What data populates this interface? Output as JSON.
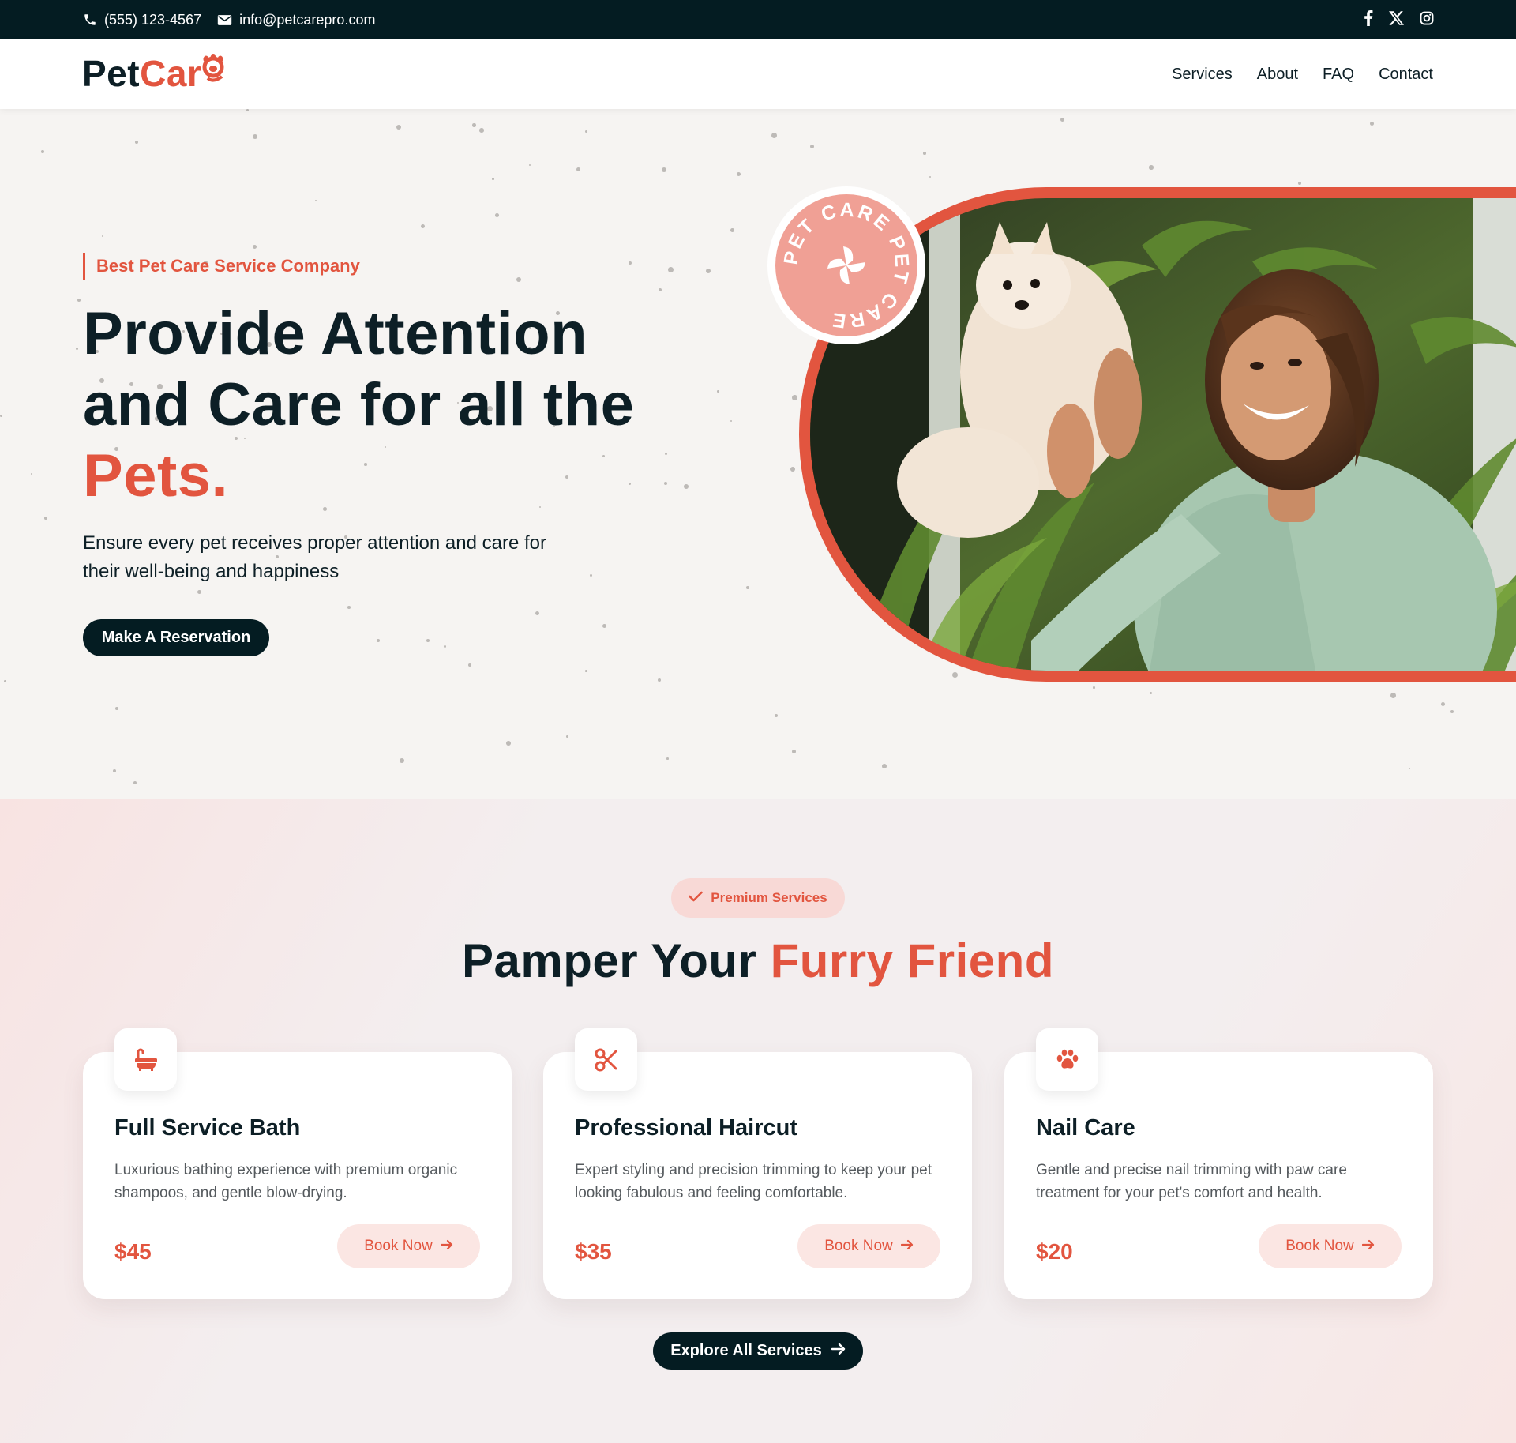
{
  "topbar": {
    "phone": "(555) 123-4567",
    "email": "info@petcarepro.com",
    "social": [
      "facebook-icon",
      "x-icon",
      "instagram-icon"
    ]
  },
  "header": {
    "logo_part1": "Pet",
    "logo_part2": "Car",
    "nav": [
      "Services",
      "About",
      "FAQ",
      "Contact"
    ]
  },
  "hero": {
    "tagline": "Best Pet Care Service Company",
    "title_line1": "Provide Attention",
    "title_line2": "and Care for all the",
    "title_accent": "Pets.",
    "description": "Ensure every pet receives proper attention and care for their well-being and happiness",
    "cta": "Make A Reservation",
    "badge_text": "PET CARE PET CARE"
  },
  "services": {
    "pill": "Premium Services",
    "title_plain": "Pamper Your",
    "title_accent": "Furry Friend",
    "cards": [
      {
        "icon": "bath-icon",
        "title": "Full Service Bath",
        "description": "Luxurious bathing experience with premium organic shampoos, and gentle blow-drying.",
        "price": "$45",
        "button": "Book Now"
      },
      {
        "icon": "scissors-icon",
        "title": "Professional Haircut",
        "description": "Expert styling and precision trimming to keep your pet looking fabulous and feeling comfortable.",
        "price": "$35",
        "button": "Book Now"
      },
      {
        "icon": "paw-icon",
        "title": "Nail Care",
        "description": "Gentle and precise nail trimming with paw care treatment for your pet's comfort and health.",
        "price": "$20",
        "button": "Book Now"
      }
    ],
    "explore": "Explore All Services"
  },
  "colors": {
    "accent": "#e2553f",
    "dark": "#041c22",
    "pill_bg": "#f8d9d6",
    "book_bg": "#fbe6e3"
  }
}
